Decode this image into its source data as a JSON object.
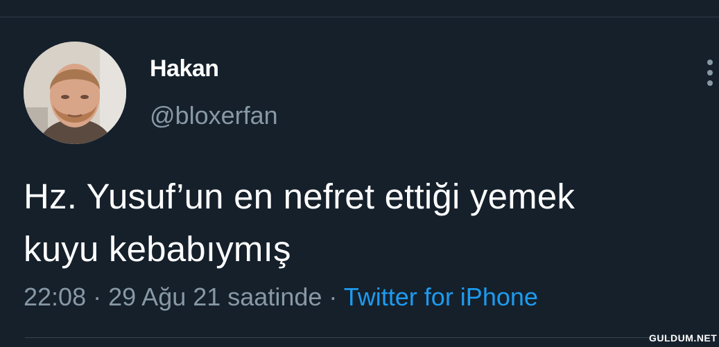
{
  "tweet": {
    "display_name": "Hakan",
    "handle": "@bloxerfan",
    "text_lines": [
      "Hz. Yusuf’un en nefret ettiği yemek",
      "kuyu kebabıymış"
    ],
    "time": "22:08",
    "date": "29 Ağu 21 saatinde",
    "separator": "·",
    "source": "Twitter for iPhone"
  },
  "icons": {
    "more": "more-vertical-icon",
    "avatar": "profile-photo"
  },
  "colors": {
    "background": "#15202b",
    "text": "#ffffff",
    "muted": "#8899a6",
    "link": "#1d9bf0"
  },
  "watermark": "GULDUM.NET"
}
